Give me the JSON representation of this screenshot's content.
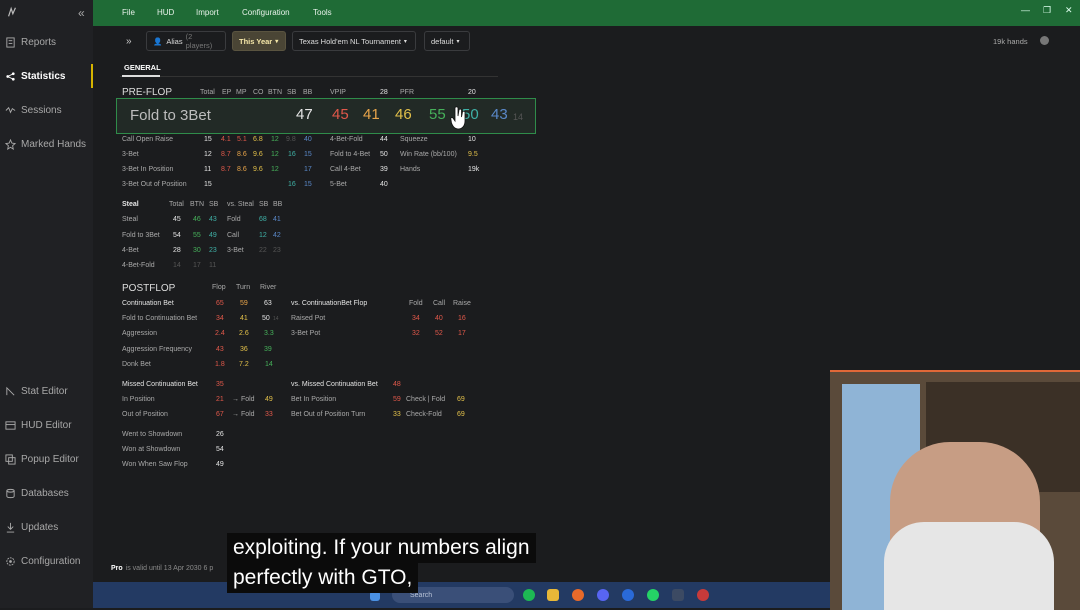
{
  "sidebar": {
    "items": [
      {
        "label": "Reports",
        "icon": "reports-icon"
      },
      {
        "label": "Statistics",
        "icon": "statistics-icon"
      },
      {
        "label": "Sessions",
        "icon": "sessions-icon"
      },
      {
        "label": "Marked Hands",
        "icon": "star-icon"
      },
      {
        "label": "Stat Editor",
        "icon": "stat-editor-icon"
      },
      {
        "label": "HUD Editor",
        "icon": "hud-editor-icon"
      },
      {
        "label": "Popup Editor",
        "icon": "popup-editor-icon"
      },
      {
        "label": "Databases",
        "icon": "database-icon"
      },
      {
        "label": "Updates",
        "icon": "download-icon"
      },
      {
        "label": "Configuration",
        "icon": "gear-icon"
      }
    ],
    "license_pro": "Pro",
    "license_text": "is valid until 13 Apr 2030",
    "license_more": "6 p"
  },
  "menubar": {
    "items": [
      "File",
      "HUD",
      "Import",
      "Configuration",
      "Tools"
    ]
  },
  "toolbar": {
    "alias_label": "Alias",
    "alias_count": "(2 players)",
    "period": "This Year",
    "game": "Texas Hold'em NL Tournament",
    "preset": "default",
    "hands": "19k hands"
  },
  "tab": "GENERAL",
  "preflop": {
    "title": "PRE-FLOP",
    "cols": [
      "Total",
      "EP",
      "MP",
      "CO",
      "BTN",
      "SB",
      "BB"
    ],
    "vpip_label": "VPIP",
    "vpip": "28",
    "pfr_label": "PFR",
    "pfr": "20",
    "rows": [
      {
        "label": "Call Open Raise",
        "v": [
          "15",
          "4.1",
          "5.1",
          "6.8",
          "12",
          "9.8",
          "40"
        ]
      },
      {
        "label": "3-Bet",
        "v": [
          "12",
          "8.7",
          "8.6",
          "9.6",
          "12",
          "16",
          "15"
        ]
      },
      {
        "label": "3-Bet In Position",
        "v": [
          "11",
          "8.7",
          "8.6",
          "9.6",
          "12",
          "",
          "17"
        ]
      },
      {
        "label": "3-Bet Out of Position",
        "v": [
          "15",
          "",
          "",
          "",
          "",
          "16",
          "15"
        ]
      }
    ],
    "right": [
      {
        "label": "4-Bet-Fold",
        "v": "44",
        "label2": "Squeeze",
        "v2": "10"
      },
      {
        "label": "Fold to 4-Bet",
        "v": "50",
        "label2": "Win Rate (bb/100)",
        "v2": "9.5"
      },
      {
        "label": "Call 4-Bet",
        "v": "39",
        "label2": "Hands",
        "v2": "19k"
      },
      {
        "label": "5-Bet",
        "v": "40",
        "label2": "",
        "v2": ""
      }
    ]
  },
  "highlight": {
    "label": "Fold to 3Bet",
    "values": [
      "47",
      "45",
      "41",
      "46",
      "55",
      "50",
      "43",
      "14"
    ]
  },
  "steal": {
    "cols": [
      "Steal",
      "Total",
      "BTN",
      "SB",
      "vs. Steal",
      "SB",
      "BB"
    ],
    "rows": [
      {
        "label": "Steal",
        "v": [
          "45",
          "46",
          "43"
        ],
        "label2": "Fold",
        "v2": [
          "68",
          "41"
        ]
      },
      {
        "label": "Fold to 3Bet",
        "v": [
          "54",
          "55",
          "49"
        ],
        "label2": "Call",
        "v2": [
          "12",
          "42"
        ]
      },
      {
        "label": "4-Bet",
        "v": [
          "28",
          "30",
          "23"
        ],
        "label2": "3-Bet",
        "v2": [
          "22",
          "23"
        ]
      },
      {
        "label": "4-Bet-Fold",
        "v": [
          "14",
          "17",
          "11"
        ],
        "label2": "",
        "v2": [
          "",
          ""
        ]
      }
    ]
  },
  "postflop": {
    "title": "POSTFLOP",
    "cols": [
      "Flop",
      "Turn",
      "River"
    ],
    "rows": [
      {
        "label": "Continuation Bet",
        "v": [
          "65",
          "59",
          "63"
        ]
      },
      {
        "label": "Fold to Continuation Bet",
        "v": [
          "34",
          "41",
          "50"
        ],
        "extra": "14"
      },
      {
        "label": "Aggression",
        "v": [
          "2.4",
          "2.6",
          "3.3"
        ]
      },
      {
        "label": "Aggression Frequency",
        "v": [
          "43",
          "36",
          "39"
        ]
      },
      {
        "label": "Donk Bet",
        "v": [
          "1.8",
          "7.2",
          "14"
        ]
      }
    ],
    "vs_title": "vs. ContinuationBet Flop",
    "vs_cols": [
      "Fold",
      "Call",
      "Raise"
    ],
    "vs_rows": [
      {
        "label": "Raised Pot",
        "v": [
          "34",
          "40",
          "16"
        ]
      },
      {
        "label": "3-Bet Pot",
        "v": [
          "32",
          "52",
          "17"
        ]
      }
    ],
    "missed": {
      "label": "Missed Continuation Bet",
      "v": "35"
    },
    "missed_rows": [
      {
        "label": "In Position",
        "v": "21",
        "arrow": "→ Fold",
        "v2": "49"
      },
      {
        "label": "Out of Position",
        "v": "67",
        "arrow": "→ Fold",
        "v2": "33"
      }
    ],
    "vs_missed": {
      "label": "vs. Missed Continuation Bet",
      "v": "48"
    },
    "vs_missed_rows": [
      {
        "label": "Bet In Position",
        "v": "59",
        "label2": "Check | Fold",
        "v2": "69"
      },
      {
        "label": "Bet Out of Position Turn",
        "v": "33",
        "label2": "Check-Fold",
        "v2": "69"
      }
    ],
    "showdown": [
      {
        "label": "Went to Showdown",
        "v": "26"
      },
      {
        "label": "Won at Showdown",
        "v": "54"
      },
      {
        "label": "Won When Saw Flop",
        "v": "49"
      }
    ]
  },
  "subtitle": {
    "line1": "exploiting. If your numbers align",
    "line2": "perfectly with GTO,"
  },
  "taskbar": {
    "search": "Search"
  }
}
